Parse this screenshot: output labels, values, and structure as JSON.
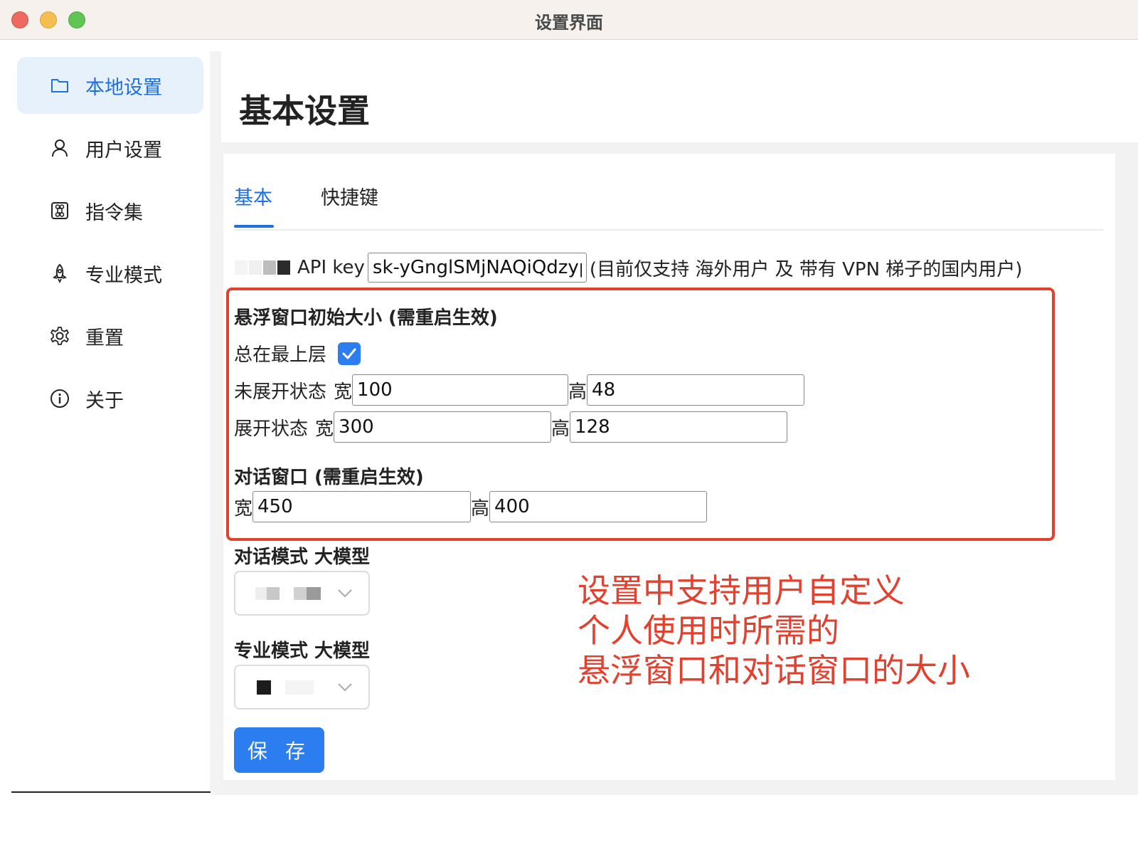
{
  "window": {
    "title": "设置界面"
  },
  "colors": {
    "accent": "#2c7ef0",
    "annotation": "#e2412f",
    "active_bg": "#e6f1fc"
  },
  "sidebar": {
    "items": [
      {
        "label": "本地设置",
        "icon": "folder-icon",
        "active": true
      },
      {
        "label": "用户设置",
        "icon": "user-icon",
        "active": false
      },
      {
        "label": "指令集",
        "icon": "command-icon",
        "active": false
      },
      {
        "label": "专业模式",
        "icon": "rocket-icon",
        "active": false
      },
      {
        "label": "重置",
        "icon": "gear-icon",
        "active": false
      },
      {
        "label": "关于",
        "icon": "info-icon",
        "active": false
      }
    ]
  },
  "main": {
    "title": "基本设置",
    "tabs": [
      {
        "label": "基本",
        "active": true
      },
      {
        "label": "快捷键",
        "active": false
      }
    ],
    "api": {
      "label": "API key",
      "value": "sk-yGnglSMjNAQiQdzyp",
      "note": "(目前仅支持 海外用户 及 带有 VPN 梯子的国内用户)"
    },
    "float_window": {
      "title": "悬浮窗口初始大小 (需重启生效)",
      "always_on_top_label": "总在最上层",
      "always_on_top": true,
      "collapsed": {
        "label": "未展开状态",
        "width_label": "宽",
        "width": "100",
        "height_label": "高",
        "height": "48"
      },
      "expanded": {
        "label": "展开状态",
        "width_label": "宽",
        "width": "300",
        "height_label": "高",
        "height": "128"
      }
    },
    "dialog_window": {
      "title": "对话窗口 (需重启生效)",
      "width_label": "宽",
      "width": "450",
      "height_label": "高",
      "height": "400"
    },
    "chat_model": {
      "label": "对话模式 大模型"
    },
    "pro_model": {
      "label": "专业模式 大模型"
    },
    "save_label": "保 存"
  },
  "annotation": {
    "line1": "设置中支持用户自定义",
    "line2": "个人使用时所需的",
    "line3": "悬浮窗口和对话窗口的大小"
  }
}
